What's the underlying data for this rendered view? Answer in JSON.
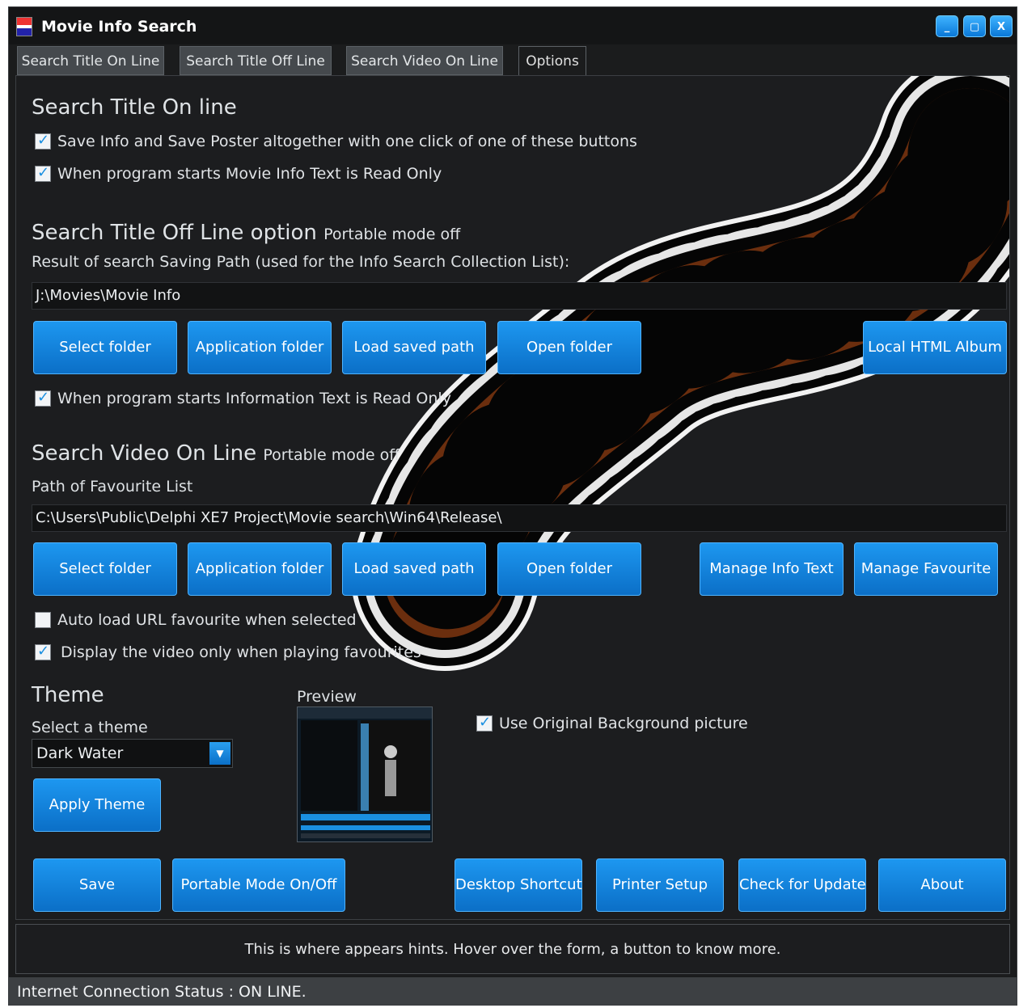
{
  "window": {
    "title": "Movie Info Search",
    "min": "_",
    "max": "▢",
    "close": "X"
  },
  "tabs": [
    "Search Title On Line",
    "Search Title Off Line",
    "Search Video On Line",
    "Options"
  ],
  "section1": {
    "heading": "Search Title On line",
    "check1": "Save Info and Save Poster altogether with one click of one of these buttons",
    "check2": "When program starts Movie Info Text is Read Only"
  },
  "section2": {
    "heading": "Search Title Off Line option",
    "mode": "Portable mode off",
    "path_label": "Result of search Saving Path (used for the Info Search Collection List):",
    "path_value": "J:\\Movies\\Movie Info",
    "buttons": [
      "Select folder",
      "Application folder",
      "Load saved path",
      "Open folder",
      "Local HTML Album"
    ],
    "check": "When program starts Information Text is Read Only"
  },
  "section3": {
    "heading": "Search Video On Line",
    "mode": "Portable mode off",
    "path_label": "Path of Favourite List",
    "path_value": "C:\\Users\\Public\\Delphi XE7 Project\\Movie search\\Win64\\Release\\",
    "buttons": [
      "Select folder",
      "Application folder",
      "Load saved path",
      "Open folder",
      "Manage Info Text",
      "Manage Favourite"
    ],
    "check1": "Auto load URL favourite when selected",
    "check2": "Display the video only when playing favourites"
  },
  "theme": {
    "heading": "Theme",
    "select_label": "Select a theme",
    "selected": "Dark Water",
    "apply": "Apply Theme",
    "preview_label": "Preview",
    "use_bg": "Use Original Background picture"
  },
  "bottom_buttons": [
    "Save",
    "Portable Mode On/Off",
    "Desktop Shortcut",
    "Printer Setup",
    "Check for Update",
    "About"
  ],
  "hint": "This is where appears hints. Hover over the form, a button to know more.",
  "status": "Internet Connection Status : ON LINE.",
  "colors": {
    "accent": "#1a8fe0",
    "background": "#1c1d1f",
    "film": "#6b2e0e"
  }
}
